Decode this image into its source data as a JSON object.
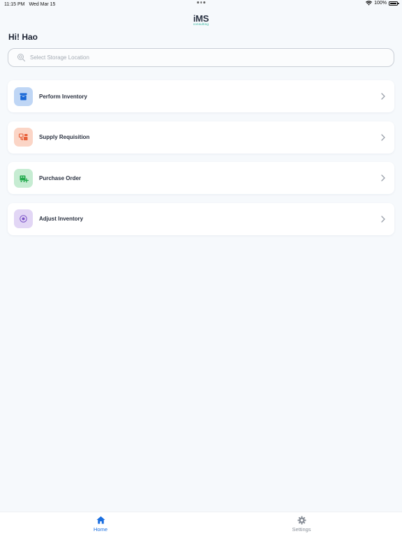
{
  "status_bar": {
    "time": "11:15 PM",
    "date": "Wed Mar 15",
    "battery": "100%",
    "battery_level": 1.0
  },
  "logo": {
    "text": "iMS",
    "sub": "consulting"
  },
  "greeting": "Hi! Hao",
  "search": {
    "placeholder": "Select Storage Location",
    "value": ""
  },
  "menu": {
    "items": [
      {
        "label": "Perform Inventory",
        "icon": "archive-box-icon",
        "icon_bg": "#bfd6f5",
        "icon_color": "#1766d6"
      },
      {
        "label": "Supply Requisition",
        "icon": "transfer-icon",
        "icon_bg": "#fbd5c6",
        "icon_color": "#e8603a"
      },
      {
        "label": "Purchase Order",
        "icon": "cart-add-icon",
        "icon_bg": "#c6ecd2",
        "icon_color": "#1fa84a"
      },
      {
        "label": "Adjust Inventory",
        "icon": "target-icon",
        "icon_bg": "#e2d6f5",
        "icon_color": "#7a52c8"
      }
    ]
  },
  "tab_bar": {
    "home": "Home",
    "settings": "Settings",
    "active_color": "#1b6fe0",
    "inactive_color": "#8a9099"
  }
}
